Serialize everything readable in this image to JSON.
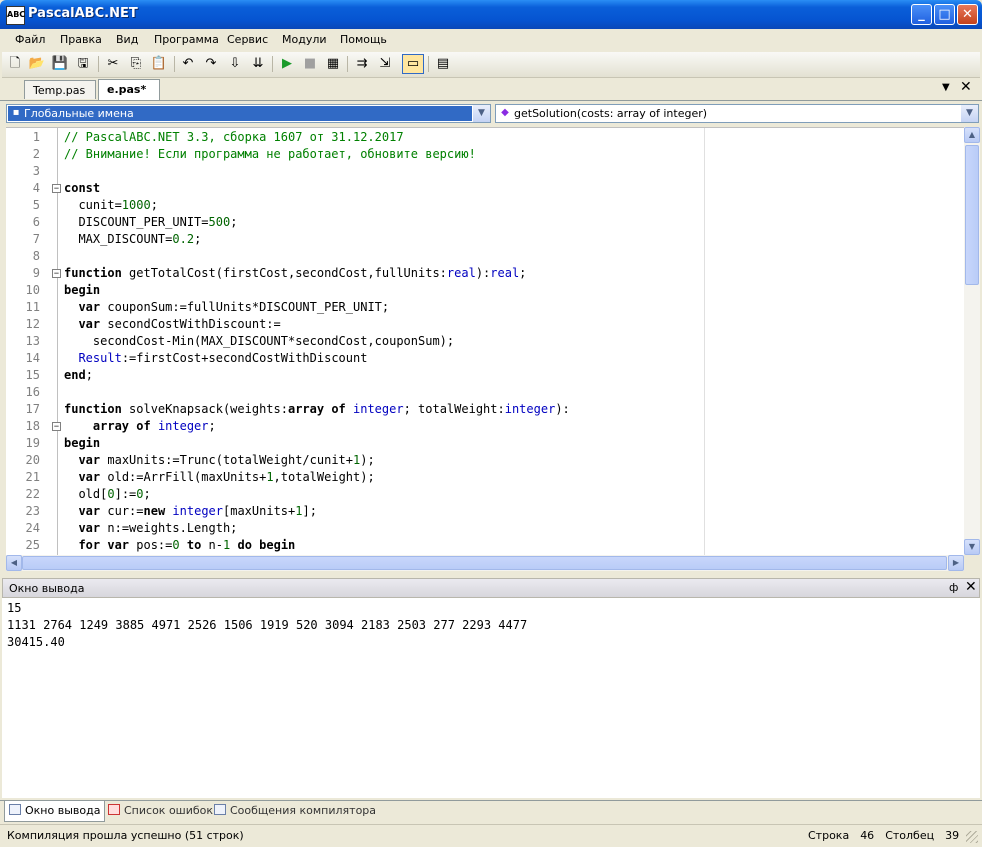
{
  "window": {
    "title": "PascalABC.NET",
    "icon_text": "ABC",
    "minimize_glyph": "_",
    "maximize_glyph": "□",
    "close_glyph": "✕"
  },
  "menu": [
    "Файл",
    "Правка",
    "Вид",
    "Программа",
    "Сервис",
    "Модули",
    "Помощь"
  ],
  "toolbar": {
    "icons": [
      "new-file-icon",
      "open-folder-icon",
      "save-icon",
      "save-all-icon",
      "cut-icon",
      "copy-icon",
      "paste-icon",
      "undo-icon",
      "redo-icon",
      "compile-icon",
      "compile-all-icon",
      "run-icon",
      "stop-icon",
      "debug-icon",
      "step-icon",
      "step-into-icon",
      "console-icon",
      "form-designer-icon"
    ],
    "glyphs": [
      "🗋",
      "📂",
      "💾",
      "🖫",
      "✂",
      "⎘",
      "📋",
      "↶",
      "↷",
      "⇩",
      "⇊",
      "▶",
      "■",
      "▦",
      "⇉",
      "⇲",
      "▭",
      "▤"
    ]
  },
  "tabs": [
    {
      "label": "Temp.pas",
      "active": false
    },
    {
      "label": "e.pas*",
      "active": true
    }
  ],
  "tab_controls": {
    "menu_glyph": "▼",
    "close_glyph": "✕"
  },
  "navigation": {
    "scope": "Глобальные имена",
    "member": "getSolution(costs: array of integer)",
    "arrow_glyph": "▼"
  },
  "editor": {
    "line_numbers": [
      "1",
      "2",
      "3",
      "4",
      "5",
      "6",
      "7",
      "8",
      "9",
      "10",
      "11",
      "12",
      "13",
      "14",
      "15",
      "16",
      "17",
      "18",
      "19",
      "20",
      "21",
      "22",
      "23",
      "24",
      "25"
    ],
    "fold_markers": [
      "−",
      "−",
      "−"
    ]
  },
  "output_panel": {
    "title": "Окно вывода",
    "pin_glyph": "📌",
    "close_glyph": "✕",
    "lines": [
      "15",
      "1131 2764 1249 3885 4971 2526 1506 1919 520 3094 2183 2503 277 2293 4477",
      "30415.40"
    ]
  },
  "bottom_tabs": [
    {
      "label": "Окно вывода",
      "active": true
    },
    {
      "label": "Список ошибок",
      "active": false
    },
    {
      "label": "Сообщения компилятора",
      "active": false
    }
  ],
  "status": {
    "message": "Компиляция прошла успешно (51 строк)",
    "row_label": "Строка",
    "row": "46",
    "col_label": "Столбец",
    "col": "39"
  },
  "colors": {
    "title_bar": "#0654d1",
    "selection": "#316ac5",
    "comment": "#008000",
    "number": "#006400",
    "type": "#0000c0"
  }
}
